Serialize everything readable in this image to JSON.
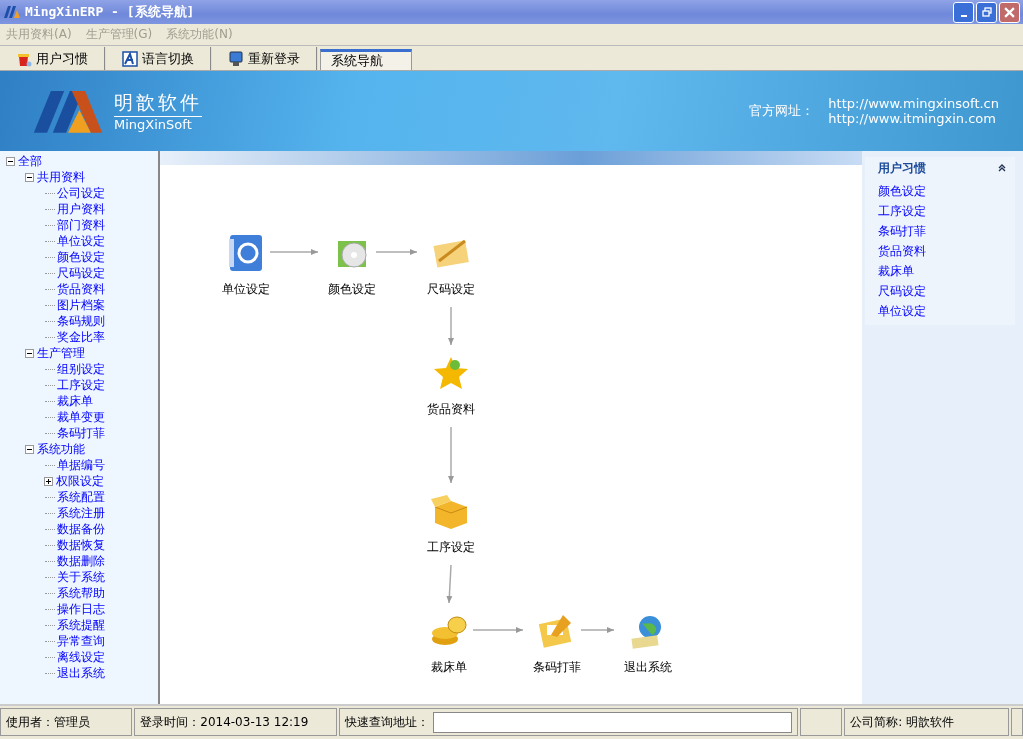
{
  "window": {
    "title": "MingXinERP - [系统导航]"
  },
  "menu": [
    {
      "label": "共用资料(A)",
      "disabled": true
    },
    {
      "label": "生产管理(G)",
      "disabled": true
    },
    {
      "label": "系统功能(N)",
      "disabled": true
    }
  ],
  "toolbar": [
    {
      "label": "用户习惯",
      "kind": "button"
    },
    {
      "label": "语言切换",
      "kind": "button"
    },
    {
      "label": "重新登录",
      "kind": "button"
    },
    {
      "label": "系统导航",
      "kind": "tab",
      "selected": true
    }
  ],
  "banner": {
    "brand_cn": "明歆软件",
    "brand_en": "MingXinSoft",
    "site_label": "官方网址：",
    "urls": [
      "http://www.mingxinsoft.cn",
      "http://www.itmingxin.com"
    ]
  },
  "tree": {
    "items": [
      {
        "label": "全部",
        "expanded": true,
        "children": [
          {
            "label": "共用资料",
            "expanded": true,
            "children": [
              {
                "label": "公司设定"
              },
              {
                "label": "用户资料"
              },
              {
                "label": "部门资料"
              },
              {
                "label": "单位设定"
              },
              {
                "label": "颜色设定"
              },
              {
                "label": "尺码设定"
              },
              {
                "label": "货品资料"
              },
              {
                "label": "图片档案"
              },
              {
                "label": "条码规则"
              },
              {
                "label": "奖金比率"
              }
            ]
          },
          {
            "label": "生产管理",
            "expanded": true,
            "children": [
              {
                "label": "组别设定"
              },
              {
                "label": "工序设定"
              },
              {
                "label": "裁床单"
              },
              {
                "label": "裁单变更"
              },
              {
                "label": "条码打菲"
              }
            ]
          },
          {
            "label": "系统功能",
            "expanded": true,
            "children": [
              {
                "label": "单据编号"
              },
              {
                "label": "权限设定",
                "expanded": false
              },
              {
                "label": "系统配置"
              },
              {
                "label": "系统注册"
              },
              {
                "label": "数据备份"
              },
              {
                "label": "数据恢复"
              },
              {
                "label": "数据删除"
              },
              {
                "label": "关于系统"
              },
              {
                "label": "系统帮助"
              },
              {
                "label": "操作日志"
              },
              {
                "label": "系统提醒"
              },
              {
                "label": "异常查询"
              },
              {
                "label": "离线设定"
              },
              {
                "label": "退出系统"
              }
            ]
          }
        ]
      }
    ]
  },
  "flow": {
    "nodes": [
      {
        "label": "单位设定"
      },
      {
        "label": "颜色设定"
      },
      {
        "label": "尺码设定"
      },
      {
        "label": "货品资料"
      },
      {
        "label": "工序设定"
      },
      {
        "label": "裁床单"
      },
      {
        "label": "条码打菲"
      },
      {
        "label": "退出系统"
      }
    ]
  },
  "quick_panel": {
    "title": "用户习惯",
    "expanded": true,
    "items": [
      "颜色设定",
      "工序设定",
      "条码打菲",
      "货品资料",
      "裁床单",
      "尺码设定",
      "单位设定"
    ]
  },
  "status_bar": {
    "user": "使用者：管理员",
    "login": "登录时间：2014-03-13 12:19",
    "query_label": "快速查询地址：",
    "company": "公司简称: 明歆软件"
  }
}
